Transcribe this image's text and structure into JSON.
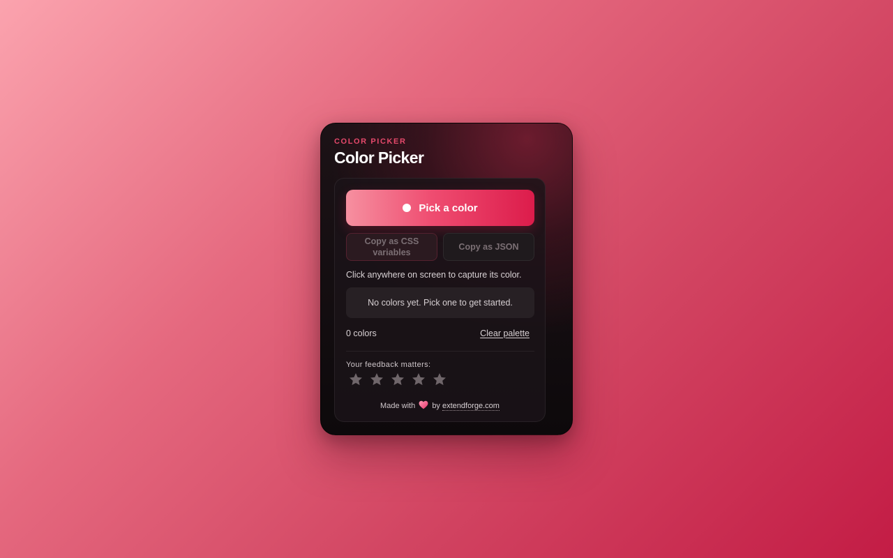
{
  "popup": {
    "eyebrow": "COLOR PICKER",
    "title": "Color Picker"
  },
  "actions": {
    "pick_label": "Pick a color",
    "copy_css_label_line1": "Copy as CSS",
    "copy_css_label_line2": "variables",
    "copy_json_label": "Copy as JSON"
  },
  "hint": "Click anywhere on screen to capture its color.",
  "palette": {
    "empty_message": "No colors yet. Pick one to get started.",
    "count_label": "0 colors",
    "clear_label": "Clear palette"
  },
  "feedback": {
    "label": "Your feedback matters:",
    "max_stars": 5,
    "rating": 0
  },
  "footer": {
    "made_with": "Made with",
    "by": "by",
    "link": "extendforge.com"
  },
  "colors": {
    "accent": "#e5496b",
    "button_start": "#f690a0",
    "button_end": "#dc1c4b",
    "star_empty": "#6f666a"
  },
  "icons": {
    "pick": "circle-dot-icon",
    "star": "star-icon",
    "heart": "heart-icon"
  }
}
